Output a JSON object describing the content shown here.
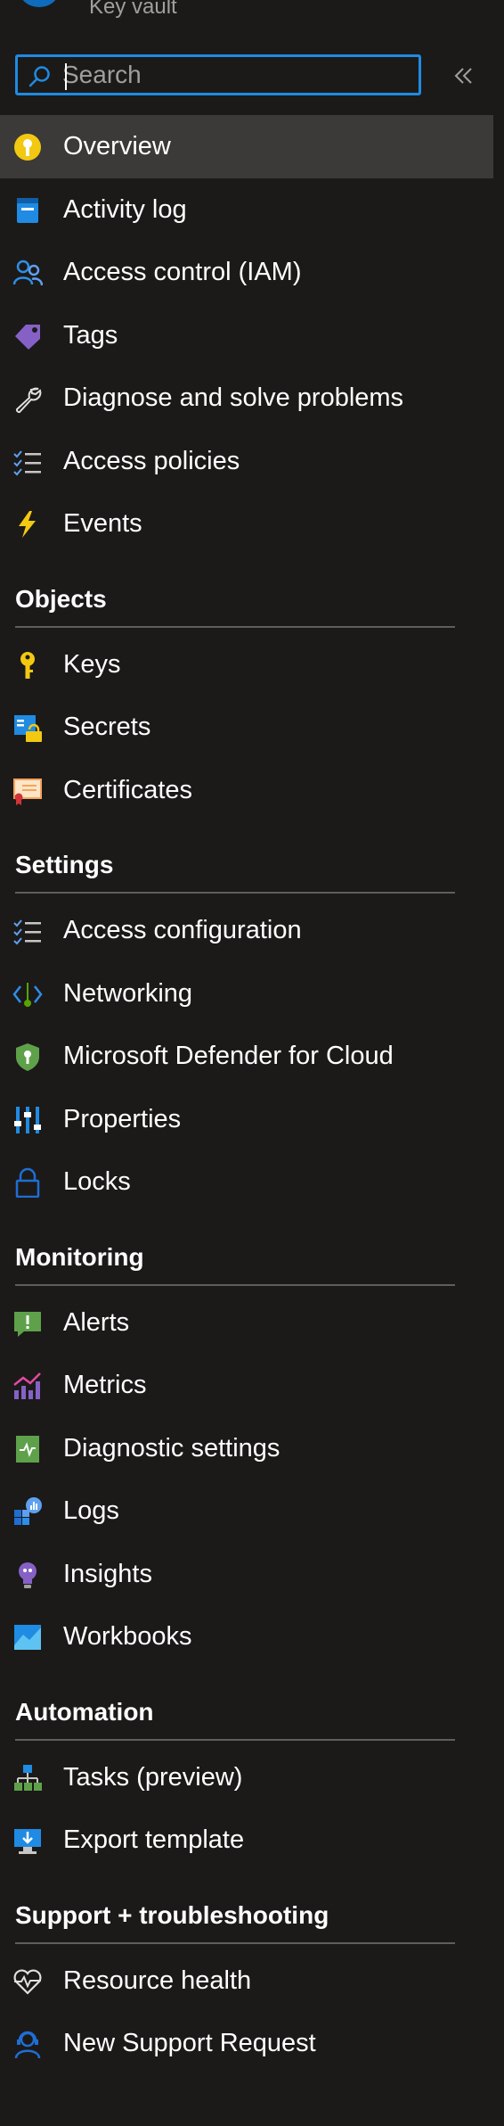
{
  "header": {
    "subtitle": "Key vault"
  },
  "search": {
    "placeholder": "Search"
  },
  "top_items": [
    {
      "label": "Overview",
      "icon": "key-vault-icon"
    },
    {
      "label": "Activity log",
      "icon": "activity-log-icon"
    },
    {
      "label": "Access control (IAM)",
      "icon": "iam-icon"
    },
    {
      "label": "Tags",
      "icon": "tag-icon"
    },
    {
      "label": "Diagnose and solve problems",
      "icon": "wrench-icon"
    },
    {
      "label": "Access policies",
      "icon": "list-check-icon"
    },
    {
      "label": "Events",
      "icon": "lightning-icon"
    }
  ],
  "sections": [
    {
      "title": "Objects",
      "items": [
        {
          "label": "Keys",
          "icon": "key-icon"
        },
        {
          "label": "Secrets",
          "icon": "secret-icon"
        },
        {
          "label": "Certificates",
          "icon": "certificate-icon"
        }
      ]
    },
    {
      "title": "Settings",
      "items": [
        {
          "label": "Access configuration",
          "icon": "list-check-icon"
        },
        {
          "label": "Networking",
          "icon": "networking-icon"
        },
        {
          "label": "Microsoft Defender for Cloud",
          "icon": "shield-icon"
        },
        {
          "label": "Properties",
          "icon": "properties-icon"
        },
        {
          "label": "Locks",
          "icon": "lock-icon"
        }
      ]
    },
    {
      "title": "Monitoring",
      "items": [
        {
          "label": "Alerts",
          "icon": "alert-icon"
        },
        {
          "label": "Metrics",
          "icon": "metrics-icon"
        },
        {
          "label": "Diagnostic settings",
          "icon": "diagnostic-icon"
        },
        {
          "label": "Logs",
          "icon": "logs-icon"
        },
        {
          "label": "Insights",
          "icon": "lightbulb-icon"
        },
        {
          "label": "Workbooks",
          "icon": "workbook-icon"
        }
      ]
    },
    {
      "title": "Automation",
      "items": [
        {
          "label": "Tasks (preview)",
          "icon": "tasks-icon"
        },
        {
          "label": "Export template",
          "icon": "export-template-icon"
        }
      ]
    },
    {
      "title": "Support + troubleshooting",
      "items": [
        {
          "label": "Resource health",
          "icon": "heart-pulse-icon"
        },
        {
          "label": "New Support Request",
          "icon": "support-person-icon"
        }
      ]
    }
  ],
  "colors": {
    "background": "#1b1a19",
    "active_row": "#3b3a39",
    "search_border": "#1f8be3",
    "divider": "#605e5c"
  }
}
